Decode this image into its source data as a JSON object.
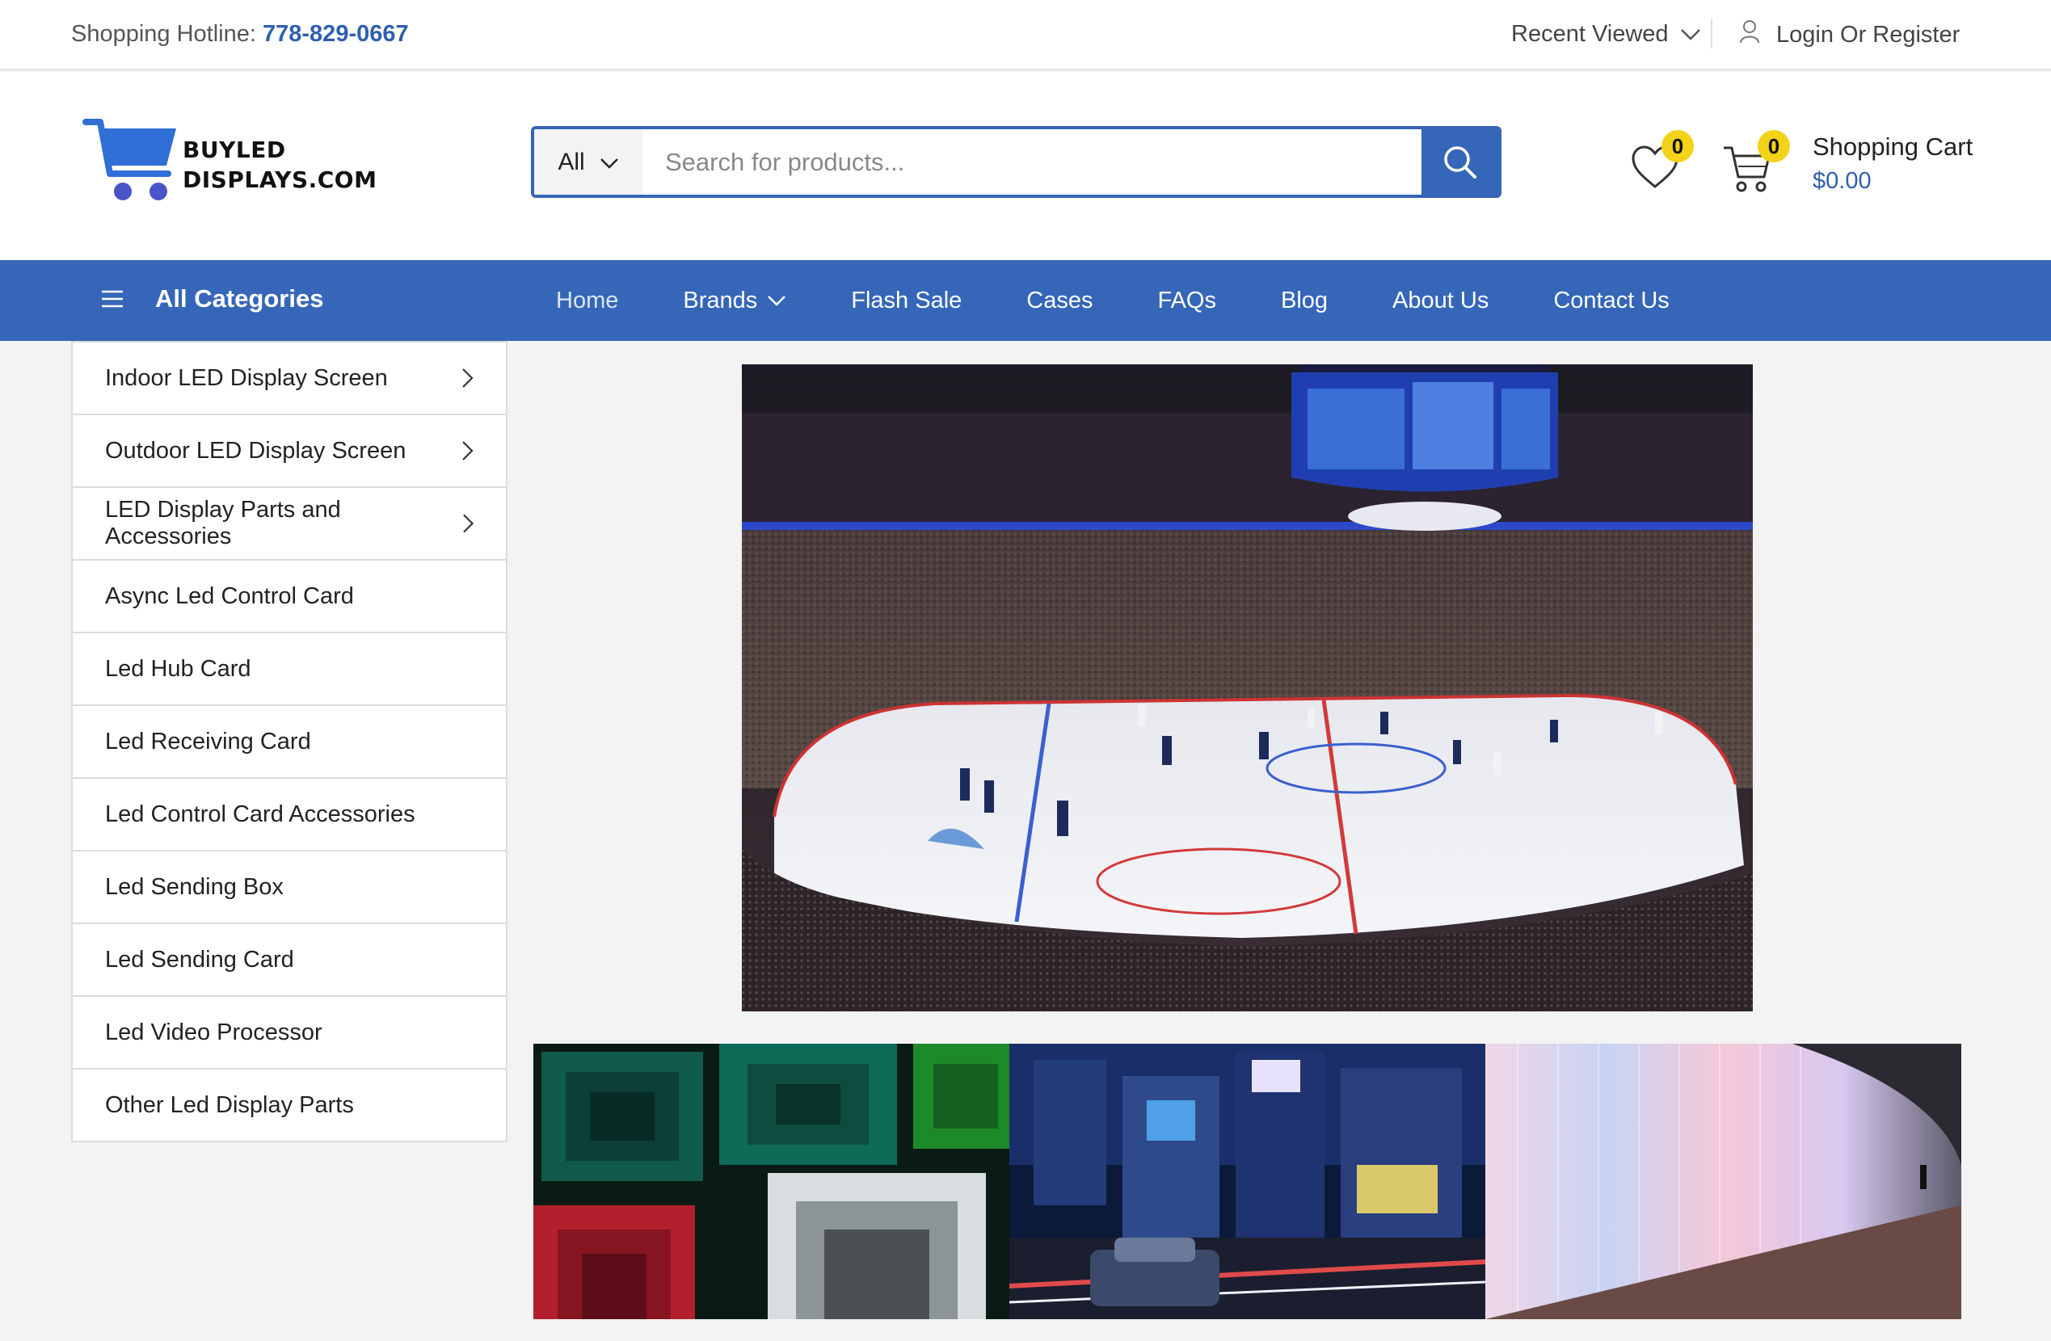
{
  "topbar": {
    "hotline_label": "Shopping Hotline:",
    "hotline_number": "778-829-0667",
    "recent_viewed": "Recent Viewed",
    "login": "Login Or Register"
  },
  "header": {
    "logo_line1": "BUYLED",
    "logo_line2": "DISPLAYS.COM",
    "search": {
      "category": "All",
      "placeholder": "Search for products..."
    },
    "wishlist_count": "0",
    "cart_count": "0",
    "cart_title": "Shopping Cart",
    "cart_total": "$0.00"
  },
  "nav": {
    "all_categories": "All Categories",
    "items": [
      {
        "label": "Home"
      },
      {
        "label": "Brands"
      },
      {
        "label": "Flash Sale"
      },
      {
        "label": "Cases"
      },
      {
        "label": "FAQs"
      },
      {
        "label": "Blog"
      },
      {
        "label": "About Us"
      },
      {
        "label": "Contact Us"
      }
    ]
  },
  "sidebar": {
    "items": [
      {
        "label": "Indoor LED Display Screen"
      },
      {
        "label": "Outdoor LED Display Screen"
      },
      {
        "label": "LED Display Parts and Accessories"
      },
      {
        "label": "Async Led Control Card"
      },
      {
        "label": "Led Hub Card"
      },
      {
        "label": "Led Receiving Card"
      },
      {
        "label": "Led Control Card Accessories"
      },
      {
        "label": "Led Sending Box"
      },
      {
        "label": "Led Sending Card"
      },
      {
        "label": "Led Video Processor"
      },
      {
        "label": "Other Led Display Parts"
      }
    ]
  },
  "colors": {
    "brand_blue": "#3566b8",
    "badge_yellow": "#f3d21a"
  }
}
